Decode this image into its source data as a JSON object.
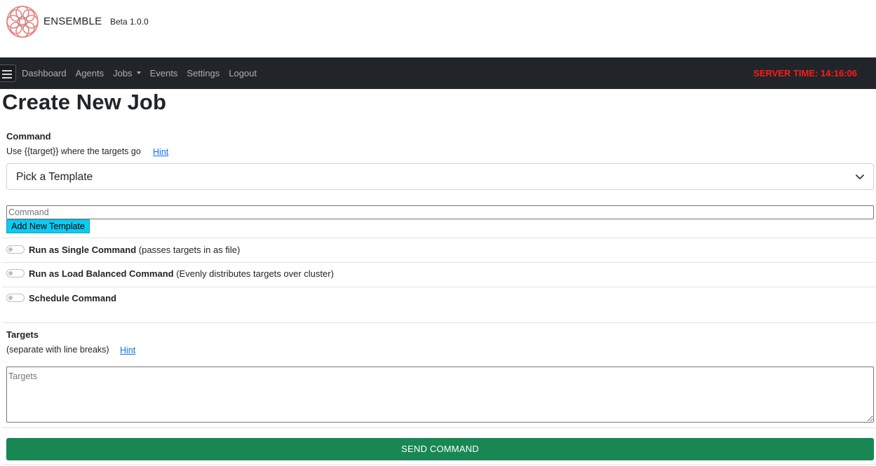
{
  "brand": {
    "name": "ENSEMBLE",
    "version": "Beta 1.0.0",
    "logo_icon": "flower-knot-logo-icon",
    "logo_color": "#e8837f"
  },
  "navbar": {
    "menu_icon": "hamburger-menu-icon",
    "links": [
      "Dashboard",
      "Agents",
      "Jobs",
      "Events",
      "Settings",
      "Logout"
    ],
    "server_time_label": "SERVER TIME: 14:16:06",
    "server_time_color": "#ff1a1a",
    "background": "#212529"
  },
  "page": {
    "title": "Create New Job"
  },
  "command": {
    "label": "Command",
    "help": "Use {{target}} where the targets go",
    "hint_label": "Hint",
    "template_select_value": "Pick a Template",
    "input_placeholder": "Command",
    "input_value": "",
    "add_template_label": "Add New Template"
  },
  "options": [
    {
      "title": "Run as Single Command",
      "description": "(passes targets in as file)",
      "enabled": false
    },
    {
      "title": "Run as Load Balanced Command",
      "description": "(Evenly distributes targets over cluster)",
      "enabled": false
    },
    {
      "title": "Schedule Command",
      "description": "",
      "enabled": false
    }
  ],
  "targets": {
    "label": "Targets",
    "help": "(separate with line breaks)",
    "hint_label": "Hint",
    "placeholder": "Targets",
    "value": ""
  },
  "send": {
    "label": "SEND COMMAND",
    "color": "#198754"
  }
}
